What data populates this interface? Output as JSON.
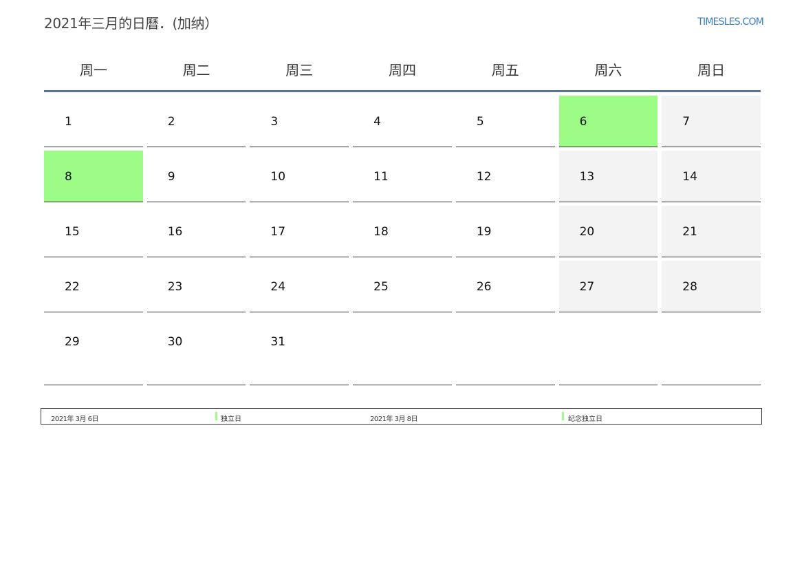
{
  "header": {
    "title": "2021年三月的日曆．(加纳）",
    "site": "TIMESLES.COM",
    "link_color": "#3b7cc4"
  },
  "calendar": {
    "weekdays": [
      "周一",
      "周二",
      "周三",
      "周四",
      "周五",
      "周六",
      "周日"
    ],
    "holiday_color": "#9dfc86",
    "weekend_color": "#f3f3f3",
    "weeks": [
      [
        {
          "day": "1",
          "kind": "normal"
        },
        {
          "day": "2",
          "kind": "normal"
        },
        {
          "day": "3",
          "kind": "normal"
        },
        {
          "day": "4",
          "kind": "normal"
        },
        {
          "day": "5",
          "kind": "normal"
        },
        {
          "day": "6",
          "kind": "holiday"
        },
        {
          "day": "7",
          "kind": "weekend"
        }
      ],
      [
        {
          "day": "8",
          "kind": "holiday"
        },
        {
          "day": "9",
          "kind": "normal"
        },
        {
          "day": "10",
          "kind": "normal"
        },
        {
          "day": "11",
          "kind": "normal"
        },
        {
          "day": "12",
          "kind": "normal"
        },
        {
          "day": "13",
          "kind": "weekend"
        },
        {
          "day": "14",
          "kind": "weekend"
        }
      ],
      [
        {
          "day": "15",
          "kind": "normal"
        },
        {
          "day": "16",
          "kind": "normal"
        },
        {
          "day": "17",
          "kind": "normal"
        },
        {
          "day": "18",
          "kind": "normal"
        },
        {
          "day": "19",
          "kind": "normal"
        },
        {
          "day": "20",
          "kind": "weekend"
        },
        {
          "day": "21",
          "kind": "weekend"
        }
      ],
      [
        {
          "day": "22",
          "kind": "normal"
        },
        {
          "day": "23",
          "kind": "normal"
        },
        {
          "day": "24",
          "kind": "normal"
        },
        {
          "day": "25",
          "kind": "normal"
        },
        {
          "day": "26",
          "kind": "normal"
        },
        {
          "day": "27",
          "kind": "weekend"
        },
        {
          "day": "28",
          "kind": "weekend"
        }
      ],
      [
        {
          "day": "29",
          "kind": "normal"
        },
        {
          "day": "30",
          "kind": "normal"
        },
        {
          "day": "31",
          "kind": "normal"
        },
        {
          "day": "",
          "kind": "empty"
        },
        {
          "day": "",
          "kind": "empty"
        },
        {
          "day": "",
          "kind": "empty"
        },
        {
          "day": "",
          "kind": "empty"
        }
      ]
    ]
  },
  "legend": {
    "entries": [
      {
        "date": "2021年 3月 6日",
        "label": "独立日"
      },
      {
        "date": "2021年 3月 8日",
        "label": "纪念独立日"
      }
    ]
  }
}
